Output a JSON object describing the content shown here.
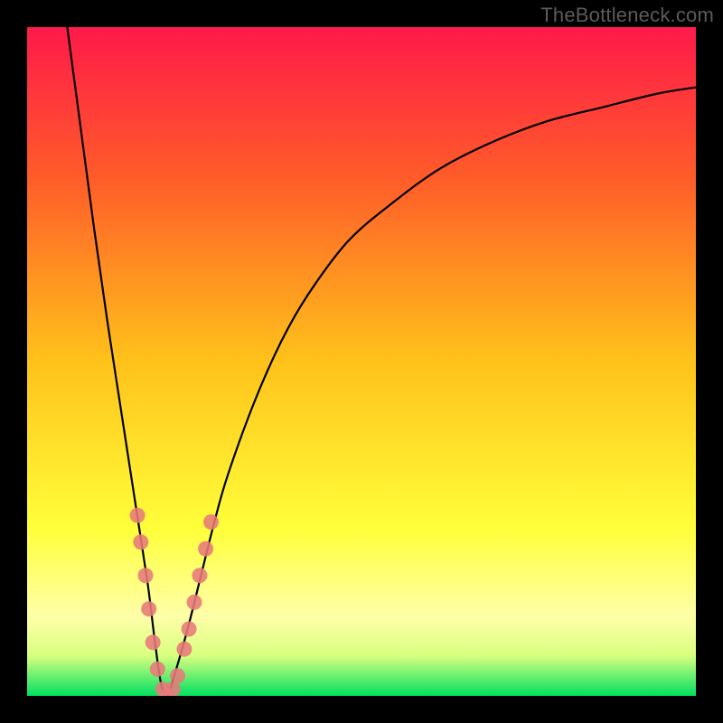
{
  "watermark": "TheBottleneck.com",
  "colors": {
    "gradient_top": "#ff1a4b",
    "gradient_upper": "#ff5a2a",
    "gradient_mid": "#ffc21a",
    "gradient_lower": "#ffff3a",
    "gradient_pale": "#ffffa8",
    "gradient_band": "#d9ff80",
    "gradient_bottom": "#00e060",
    "curve": "#000000",
    "marker": "#e77a7a",
    "frame": "#000000"
  },
  "chart_data": {
    "type": "line",
    "title": "",
    "xlabel": "",
    "ylabel": "",
    "xlim": [
      0,
      100
    ],
    "ylim": [
      0,
      100
    ],
    "grid": false,
    "series": [
      {
        "name": "bottleneck-curve",
        "x": [
          6,
          8,
          10,
          12,
          14,
          16,
          18,
          19,
          20,
          21,
          22,
          24,
          26,
          28,
          30,
          34,
          38,
          42,
          48,
          55,
          62,
          70,
          78,
          86,
          94,
          100
        ],
        "y": [
          100,
          85,
          70,
          56,
          43,
          30,
          17,
          9,
          2,
          0,
          3,
          10,
          18,
          26,
          33,
          44,
          53,
          60,
          68,
          74,
          79,
          83,
          86,
          88,
          90,
          91
        ]
      }
    ],
    "markers": [
      {
        "x": 16.5,
        "y": 27
      },
      {
        "x": 17.0,
        "y": 23
      },
      {
        "x": 17.7,
        "y": 18
      },
      {
        "x": 18.2,
        "y": 13
      },
      {
        "x": 18.8,
        "y": 8
      },
      {
        "x": 19.5,
        "y": 4
      },
      {
        "x": 20.3,
        "y": 1
      },
      {
        "x": 21.0,
        "y": 0
      },
      {
        "x": 21.8,
        "y": 1
      },
      {
        "x": 22.5,
        "y": 3
      },
      {
        "x": 23.5,
        "y": 7
      },
      {
        "x": 24.2,
        "y": 10
      },
      {
        "x": 25.0,
        "y": 14
      },
      {
        "x": 25.8,
        "y": 18
      },
      {
        "x": 26.7,
        "y": 22
      },
      {
        "x": 27.5,
        "y": 26
      }
    ],
    "notes": "V-shaped bottleneck curve on vertical red→yellow→green gradient. No axis ticks or grid. Markers are small salmon dots clustered near the valley. Values are approximate pixel readings; axes are unlabeled so x,y are in 0–100 normalized units."
  }
}
